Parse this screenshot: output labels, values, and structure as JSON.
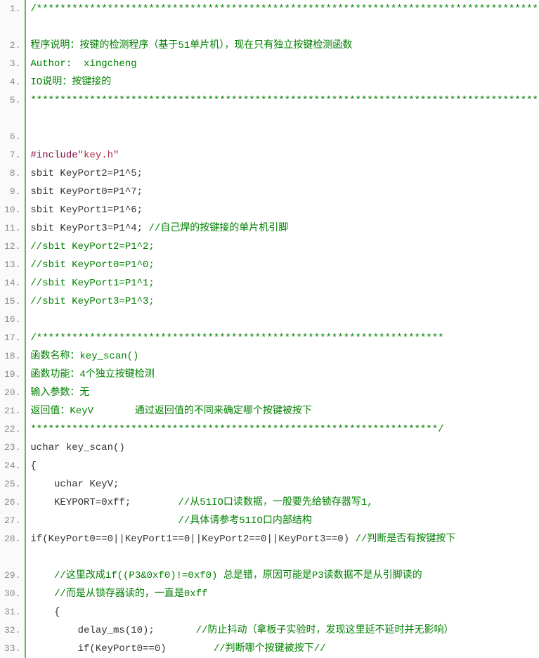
{
  "lines": [
    {
      "n": 1,
      "tall": true,
      "t": "/************************************************************************************************",
      "cls": "comment"
    },
    {
      "n": 2,
      "t": "程序说明：按键的检测程序（基于51单片机），现在只有独立按键检测函数",
      "cls": "comment"
    },
    {
      "n": 3,
      "t": "Author:  xingcheng",
      "cls": "comment"
    },
    {
      "n": 4,
      "t": "IO说明：按键接的",
      "cls": "comment"
    },
    {
      "n": 5,
      "tall": true,
      "t": "*************************************************************************************************/",
      "cls": "comment"
    },
    {
      "n": 6,
      "t": " ",
      "cls": "plain"
    },
    {
      "n": 7,
      "parts": [
        {
          "txt": "#include",
          "cls": "preproc"
        },
        {
          "txt": "\"key.h\"",
          "cls": "string"
        }
      ]
    },
    {
      "n": 8,
      "t": "sbit KeyPort2=P1^5;",
      "cls": "plain"
    },
    {
      "n": 9,
      "t": "sbit KeyPort0=P1^7;",
      "cls": "plain"
    },
    {
      "n": 10,
      "t": "sbit KeyPort1=P1^6;",
      "cls": "plain"
    },
    {
      "n": 11,
      "parts": [
        {
          "txt": "sbit KeyPort3=P1^4; ",
          "cls": "plain"
        },
        {
          "txt": "//自己焊的按键接的单片机引脚",
          "cls": "comment"
        }
      ]
    },
    {
      "n": 12,
      "t": "//sbit KeyPort2=P1^2;",
      "cls": "comment"
    },
    {
      "n": 13,
      "t": "//sbit KeyPort0=P1^0;",
      "cls": "comment"
    },
    {
      "n": 14,
      "t": "//sbit KeyPort1=P1^1;",
      "cls": "comment"
    },
    {
      "n": 15,
      "t": "//sbit KeyPort3=P1^3;",
      "cls": "comment"
    },
    {
      "n": 16,
      "t": " ",
      "cls": "plain"
    },
    {
      "n": 17,
      "t": "/*********************************************************************",
      "cls": "comment"
    },
    {
      "n": 18,
      "t": "函数名称：key_scan()",
      "cls": "comment"
    },
    {
      "n": 19,
      "t": "函数功能：4个独立按键检测",
      "cls": "comment"
    },
    {
      "n": 20,
      "t": "输入参数：无",
      "cls": "comment"
    },
    {
      "n": 21,
      "t": "返回值：KeyV       通过返回值的不同来确定哪个按键被按下",
      "cls": "comment"
    },
    {
      "n": 22,
      "t": "*********************************************************************/",
      "cls": "comment"
    },
    {
      "n": 23,
      "t": "uchar key_scan()",
      "cls": "plain"
    },
    {
      "n": 24,
      "t": "{",
      "cls": "plain"
    },
    {
      "n": 25,
      "t": "    uchar KeyV;",
      "cls": "plain"
    },
    {
      "n": 26,
      "parts": [
        {
          "txt": "    KEYPORT=0xff;        ",
          "cls": "plain"
        },
        {
          "txt": "//从51IO口读数据，一般要先给锁存器写1,",
          "cls": "comment"
        }
      ]
    },
    {
      "n": 27,
      "parts": [
        {
          "txt": "                         ",
          "cls": "plain"
        },
        {
          "txt": "//具体请参考51IO口内部结构",
          "cls": "comment"
        }
      ]
    },
    {
      "n": 28,
      "tall": true,
      "parts": [
        {
          "txt": "    if(KeyPort0==0||KeyPort1==0||KeyPort2==0||KeyPort3==0)        ",
          "cls": "plain"
        },
        {
          "txt": "//判断是否有按键按下",
          "cls": "comment"
        }
      ]
    },
    {
      "n": 29,
      "parts": [
        {
          "txt": "    ",
          "cls": "plain"
        },
        {
          "txt": "//这里改成if((P3&0xf0)!=0xf0) 总是错，原因可能是P3读数据不是从引脚读的",
          "cls": "comment"
        }
      ]
    },
    {
      "n": 30,
      "parts": [
        {
          "txt": "    ",
          "cls": "plain"
        },
        {
          "txt": "//而是从锁存器读的，一直是0xff",
          "cls": "comment"
        }
      ]
    },
    {
      "n": 31,
      "t": "    {",
      "cls": "plain"
    },
    {
      "n": 32,
      "parts": [
        {
          "txt": "        delay_ms(10);       ",
          "cls": "plain"
        },
        {
          "txt": "//防止抖动（拿板子实验时，发现这里延不延时并无影响）",
          "cls": "comment"
        }
      ]
    },
    {
      "n": 33,
      "parts": [
        {
          "txt": "        if(KeyPort0==0)        ",
          "cls": "plain"
        },
        {
          "txt": "//判断哪个按键被按下//",
          "cls": "comment"
        }
      ]
    }
  ]
}
